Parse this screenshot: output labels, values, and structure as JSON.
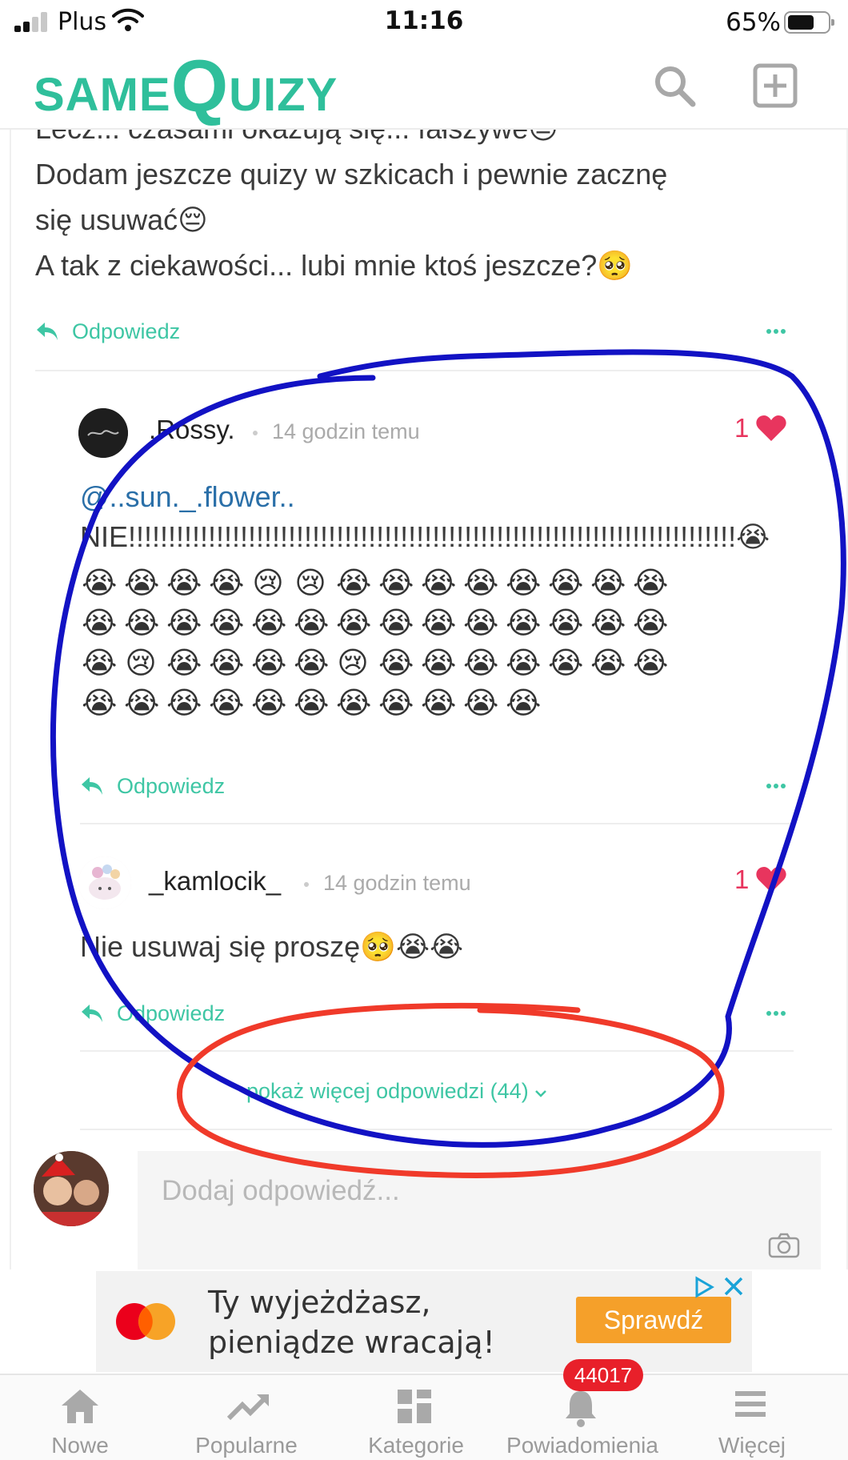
{
  "status_bar": {
    "carrier": "Plus",
    "time": "11:16",
    "battery": "65%"
  },
  "header": {
    "logo_part1": "SAME",
    "logo_part2": "Q",
    "logo_part3": "UIZY"
  },
  "comment": {
    "lines": "Lecz... czasami okazują się... fałszywe😔\nDodam jeszcze quizy w szkicach i pewnie zacznę\nsię usuwać😔\nA tak z ciekawości... lubi mnie ktoś jeszcze?🥺",
    "reply_label": "Odpowiedz"
  },
  "replies": [
    {
      "username": ".Rossy.",
      "time": "14 godzin temu",
      "likes": "1",
      "mention": "@..sun._.flower..",
      "text_line": "NIE!!!!!!!!!!!!!!!!!!!!!!!!!!!!!!!!!!!!!!!!!!!!!!!!!!!!!!!!!!!!!!!!!!!!!!!!!!!!😭",
      "emojis": [
        "😭",
        "😭",
        "😭",
        "😭",
        "😢",
        "😢",
        "😭",
        "😭",
        "😭",
        "😭",
        "😭",
        "😭",
        "😭",
        "😭",
        "😭",
        "😭",
        "😭",
        "😭",
        "😭",
        "😭",
        "😭",
        "😭",
        "😭",
        "😭",
        "😭",
        "😭",
        "😭",
        "😭",
        "😭",
        "😢",
        "😭",
        "😭",
        "😭",
        "😭",
        "😢",
        "😭",
        "😭",
        "😭",
        "😭",
        "😭",
        "😭",
        "😭",
        "😭",
        "😭",
        "😭",
        "😭",
        "😭",
        "😭",
        "😭",
        "😭",
        "😭",
        "😭",
        "😭"
      ],
      "reply_label": "Odpowiedz"
    },
    {
      "username": "_kamlocik_",
      "time": "14 godzin temu",
      "likes": "1",
      "text": "Nie usuwaj się proszę🥺😭😭",
      "reply_label": "Odpowiedz"
    }
  ],
  "show_more": "pokaż więcej odpowiedzi (44)",
  "composer": {
    "placeholder": "Dodaj odpowiedź..."
  },
  "ad": {
    "text": "Ty wyjeżdżasz,\npieniądze wracają!",
    "cta": "Sprawdź"
  },
  "bottom_nav": {
    "items": [
      {
        "label": "Nowe",
        "icon": "home-icon"
      },
      {
        "label": "Popularne",
        "icon": "trending-icon"
      },
      {
        "label": "Kategorie",
        "icon": "grid-icon"
      },
      {
        "label": "Powiadomienia",
        "icon": "bell-icon",
        "badge": "44017"
      },
      {
        "label": "Więcej",
        "icon": "menu-icon"
      }
    ]
  },
  "colors": {
    "brand": "#2fbf9b",
    "accent": "#3ec6a4",
    "like": "#e8355e",
    "mention": "#2a6fa8",
    "annotation_blue": "#1010c8",
    "annotation_red": "#f03a2a"
  }
}
